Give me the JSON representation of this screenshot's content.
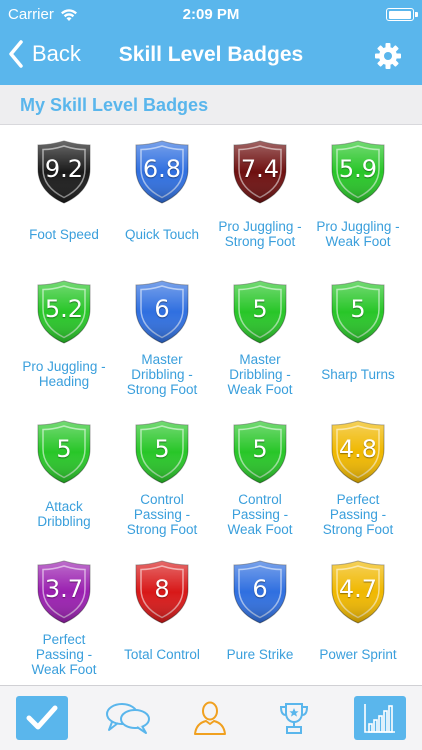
{
  "status_bar": {
    "carrier": "Carrier",
    "time": "2:09 PM"
  },
  "nav": {
    "back_label": "Back",
    "title": "Skill Level Badges"
  },
  "section": {
    "title": "My Skill Level Badges"
  },
  "colors": {
    "accent": "#5ab6ec",
    "label": "#3a9fdc",
    "black": "#1a1a1a",
    "blue": "#2f6fe0",
    "maroon": "#6e1010",
    "green": "#28c628",
    "purple": "#9a1fb0",
    "red": "#d81818",
    "yellow": "#f0b800"
  },
  "badges": [
    {
      "score": "9.2",
      "label": "Foot Speed",
      "color": "black"
    },
    {
      "score": "6.8",
      "label": "Quick Touch",
      "color": "blue"
    },
    {
      "score": "7.4",
      "label": "Pro Juggling - Strong Foot",
      "color": "maroon"
    },
    {
      "score": "5.9",
      "label": "Pro Juggling - Weak Foot",
      "color": "green"
    },
    {
      "score": "5.2",
      "label": "Pro Juggling - Heading",
      "color": "green"
    },
    {
      "score": "6",
      "label": "Master Dribbling - Strong Foot",
      "color": "blue"
    },
    {
      "score": "5",
      "label": "Master Dribbling - Weak Foot",
      "color": "green"
    },
    {
      "score": "5",
      "label": "Sharp Turns",
      "color": "green"
    },
    {
      "score": "5",
      "label": "Attack Dribbling",
      "color": "green"
    },
    {
      "score": "5",
      "label": "Control Passing - Strong Foot",
      "color": "green"
    },
    {
      "score": "5",
      "label": "Control Passing - Weak Foot",
      "color": "green"
    },
    {
      "score": "4.8",
      "label": "Perfect Passing - Strong Foot",
      "color": "yellow"
    },
    {
      "score": "3.7",
      "label": "Perfect Passing - Weak Foot",
      "color": "purple"
    },
    {
      "score": "8",
      "label": "Total Control",
      "color": "red"
    },
    {
      "score": "6",
      "label": "Pure Strike",
      "color": "blue"
    },
    {
      "score": "4.7",
      "label": "Power Sprint",
      "color": "yellow"
    }
  ],
  "tabs": [
    {
      "icon": "checkmark-icon",
      "active": true
    },
    {
      "icon": "chat-bubbles-icon",
      "active": false
    },
    {
      "icon": "person-icon",
      "active": false
    },
    {
      "icon": "trophy-icon",
      "active": false
    },
    {
      "icon": "bar-chart-icon",
      "active": true
    }
  ]
}
